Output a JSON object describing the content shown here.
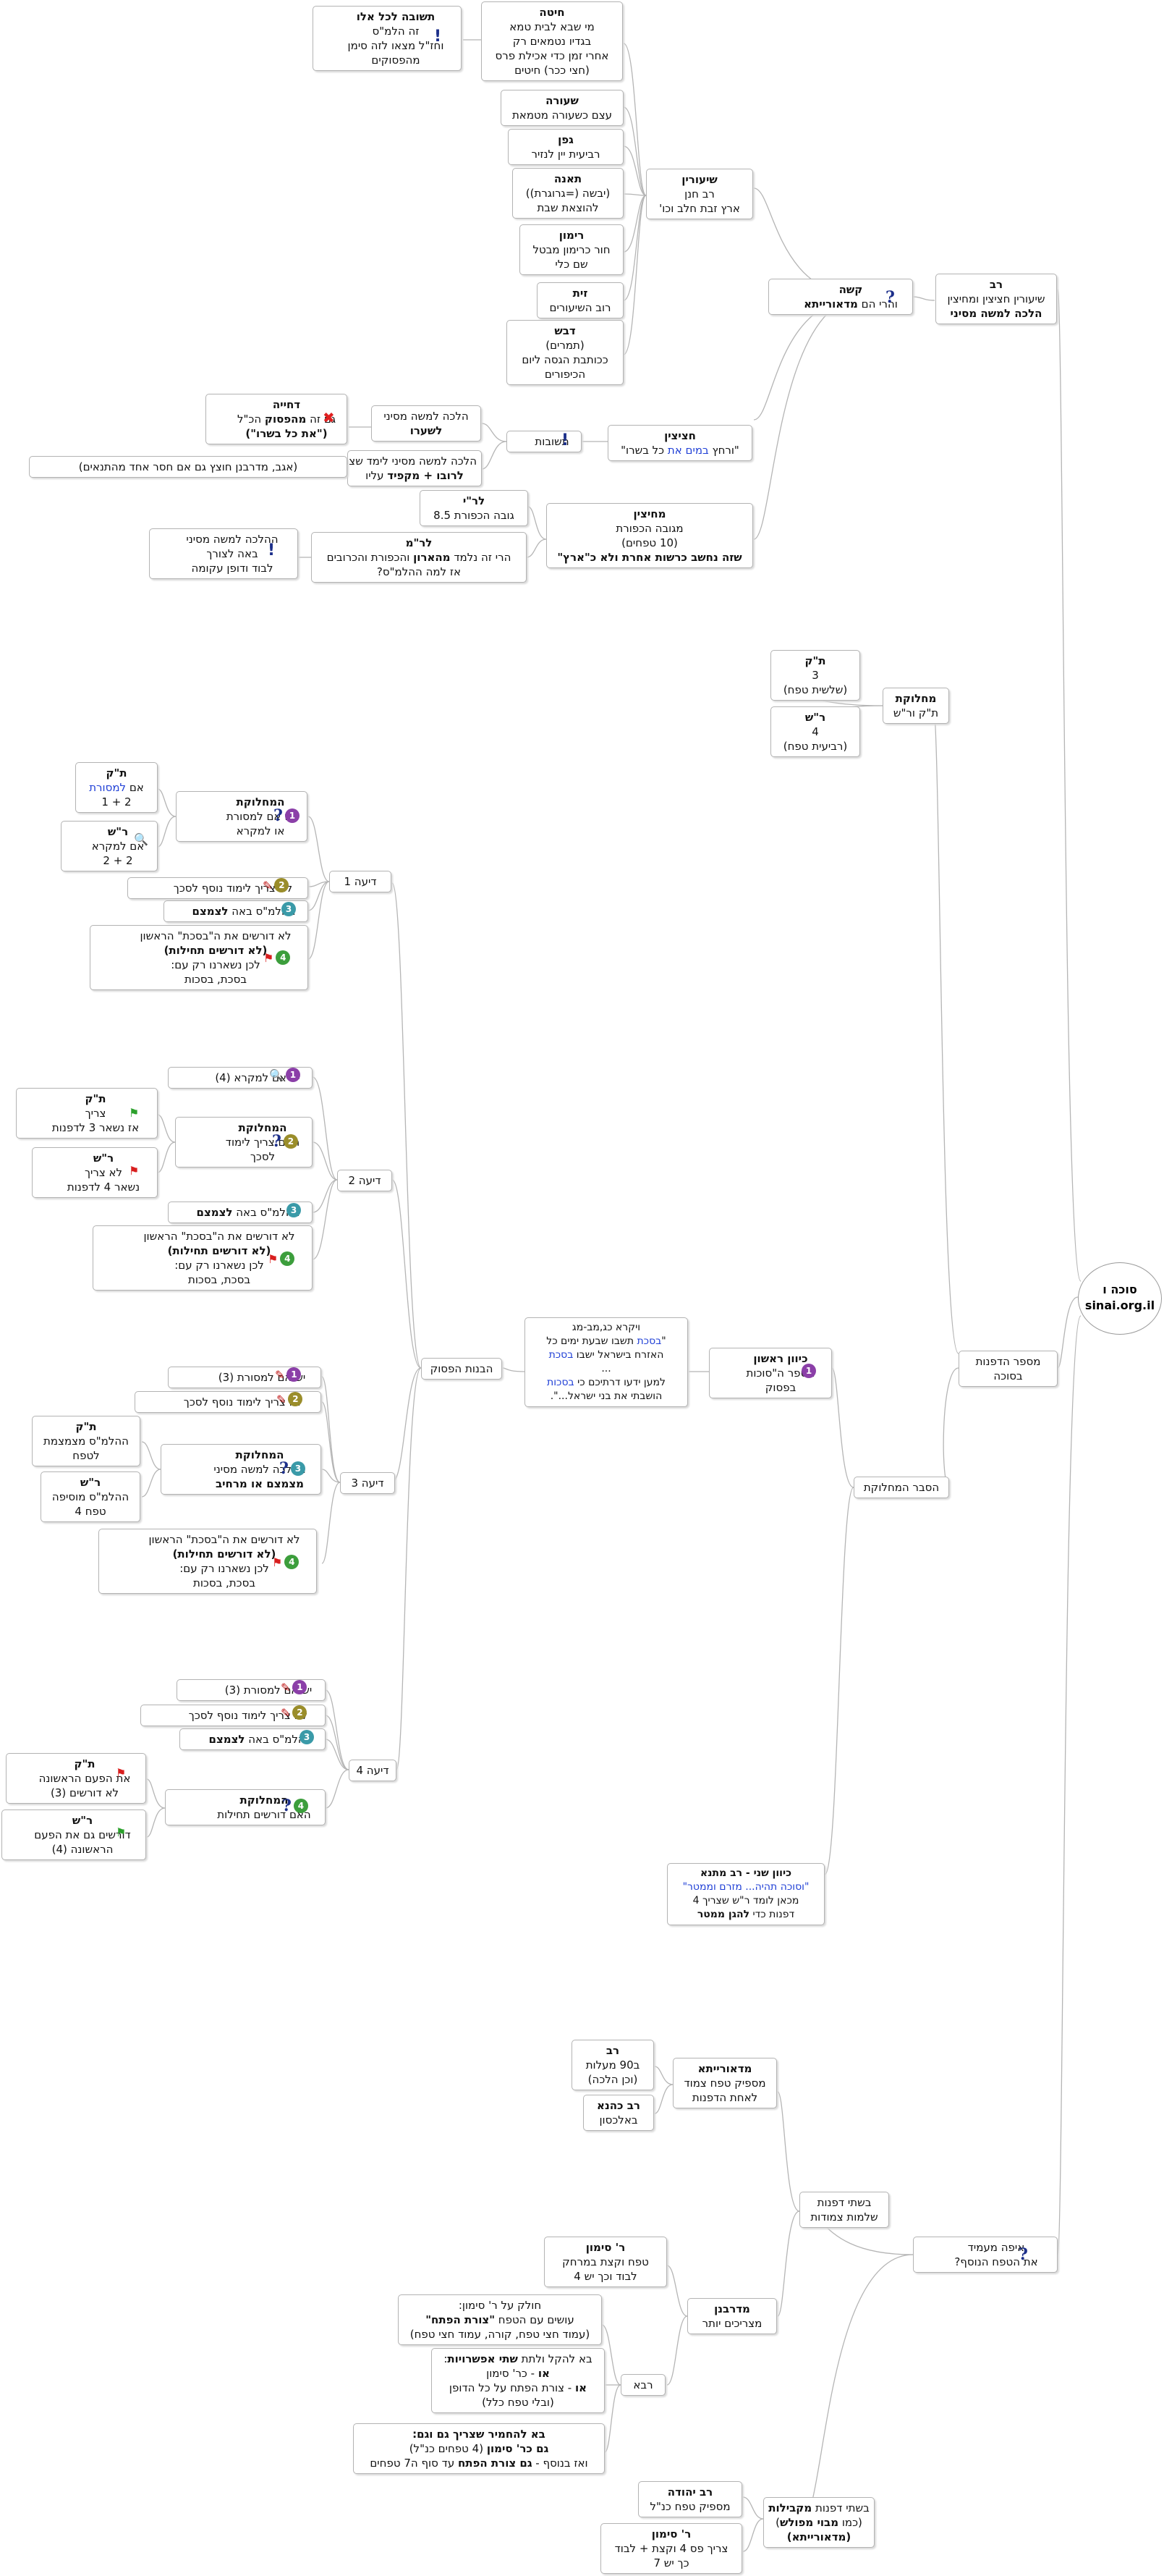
{
  "root": {
    "l1": "סוכה ו",
    "l2": "sinai.org.il"
  },
  "rav": {
    "t": "רב",
    "l1": "שיעורין חציצין ומחיצין",
    "l2": "הלכה למשה מסיני"
  },
  "kasheh": {
    "t": "קשה",
    "l1a": "והרי הם ",
    "l1b": "מדאורייתא"
  },
  "shiurin": {
    "t": "שיעורין",
    "l1": "רב חנן",
    "l2": "ארץ זבת חלב וכו'"
  },
  "chita": {
    "t": "חיטה",
    "l1": "מי שבא לבית טמא",
    "l2": "בגדיו נטמאים רק",
    "l3": "אחרי זמן כדי אכילת פרס",
    "l4": "(חצי ככר) חיטים"
  },
  "teshuva": {
    "t": "תשובה לכל אלו",
    "l1": "זה הלמ\"ס",
    "l2": "וחז\"ל מצאו לזה סימן",
    "l3": "מהפסוקים"
  },
  "seora": {
    "t": "שעורה",
    "l1": "עצם כשעורה מטמאת"
  },
  "gefen": {
    "t": "גפן",
    "l1": "רביעית יין לנזיר"
  },
  "teena": {
    "t": "תאנה",
    "l1": "(יבשה (=גרוגרת))",
    "l2": "להוצאת שבת"
  },
  "rimon": {
    "t": "רימון",
    "l1": "חור כרימון מבטל",
    "l2": "שם כלי"
  },
  "zayit": {
    "t": "זית",
    "l1": "רוב השיעורים"
  },
  "dvash": {
    "t": "דבש",
    "l1": "(תמרים)",
    "l2": "ככותבת הגסה ליום",
    "l3": "הכיפורים"
  },
  "chatzitzin": {
    "t": "חציצין",
    "l1a": "\"ורחץ ",
    "l1b": "במים את",
    "l1c": " כל בשרו\""
  },
  "teshuvot": {
    "l1": "תשובות"
  },
  "hlmm_sheiro": {
    "l1": "הלכה למשה מסיני",
    "l2": "לשערו"
  },
  "dchiya": {
    "t": "דחייה",
    "l1a": "גם זה ",
    "l1b": "מהפסוק",
    "l1c": " הכ\"ל",
    "l2": "(\"את כל בשרו\")"
  },
  "hlmm_tzarich": {
    "l1": "הלכה למשה מסיני לימד שצריך:",
    "l2a": "לרובו + מקפיד",
    "l2b": " עליו"
  },
  "agav": {
    "l1": "(אגב, מדרבנן חוצץ גם אם חסר אחד מהתנאים)"
  },
  "mechitzin": {
    "t": "מחיצין",
    "l1": "מגובה הכפורת",
    "l2": "(10 טפחים)",
    "l3": "שזה נחשב כרשות אחרת ולא כ\"ארץ\""
  },
  "lrav": {
    "t": "לר\"י",
    "l1": "גובה הכפורת 8.5"
  },
  "lram": {
    "t": "לר\"מ",
    "l1a": "הרי זה נלמד ",
    "l1b": "מהארון",
    "l1c": " והכפורת והכרובים",
    "l2": "אז למה ההלמ\"ס?"
  },
  "halacha_lvad": {
    "l1": "ההלכה למשה מסיני",
    "l2": "באה לצורך",
    "l3": "לבוד ודופן עקומה"
  },
  "machloket_tk": {
    "t": "מחלוקת",
    "l1": "ת\"ק ור\"ש"
  },
  "tk_top": {
    "t": "ת\"ק",
    "l1": "3",
    "l2": "(שלשית טפח)"
  },
  "rs_top": {
    "t": "ר\"ש",
    "l1": "4",
    "l2": "(רביעית טפח)"
  },
  "mispar": {
    "l1": "מספר הדפנות",
    "l2": "בסוכה"
  },
  "hesber": {
    "l1": "הסבר המחלוקת"
  },
  "kivun1": {
    "t": "כיוון ראשון",
    "l1": "מספר ה\"סוכות",
    "l2": "בפסוק"
  },
  "verse1": {
    "l1": "ויקרא כג,מב-מג",
    "l2a": "\"",
    "l2b": "בסכת",
    "l2c": " תשבו שבעת ימים כל",
    "l3a": "האזרח בישראל ישבו ",
    "l3b": "בסכת",
    "l4": "...",
    "l5": "למען ידעו דרתיכם כי ",
    "l5b": "בסכות",
    "l6": "הושבתי את בני ישראל...\"."
  },
  "havanat": {
    "l1": "הבנות הפסוק"
  },
  "deia1": {
    "l1": "דיעה 1"
  },
  "deia2": {
    "l1": "דיעה 2"
  },
  "deia3": {
    "l1": "דיעה 3"
  },
  "deia4": {
    "l1": "דיעה 4"
  },
  "d1_mach": {
    "t": "המחלוקת",
    "l1": "יש אם למסורת",
    "l2": "או למקרא"
  },
  "d1_tk": {
    "t": "ת\"ק",
    "l1a": "אם ",
    "l1b": "למסורת",
    "l2": "2 + 1"
  },
  "d1_rs": {
    "t": "ר\"ש",
    "l1": "אם למקרא",
    "l2": "2 + 2"
  },
  "d1_n2": {
    "l1": "לא צריך לימוד נוסף לסכך"
  },
  "d1_n3": {
    "l1": "ההלמ\"ס באה ",
    "l1b": "לצמצם"
  },
  "d1_n4": {
    "l1": "לא דורשים את ה\"בסכת\" הראשון",
    "l2": "(לא דורשים תחילות)",
    "l3": "לכן נשארנו רק עם:",
    "l4": "בסכת, בסכות"
  },
  "d2_n1": {
    "l1": "יש אם למקרא (4)"
  },
  "d2_mach": {
    "t": "המחלוקת",
    "l1": "האם צריך לימוד",
    "l2": "לסכך"
  },
  "d2_tk": {
    "t": "ת\"ק",
    "l1": "צריך",
    "l2": "אז נשאר 3 לדפנות"
  },
  "d2_rs": {
    "t": "ר\"ש",
    "l1": "לא צריך",
    "l2": "נשאר 4 לדפנות"
  },
  "d2_n3": {
    "l1": "ההלמ\"ס באה ",
    "l1b": "לצמצם"
  },
  "d2_n4": {
    "l1": "לא דורשים את ה\"בסכת\" הראשון",
    "l2": "(לא דורשים תחילות)",
    "l3": "לכן נשארנו רק עם:",
    "l4": "בסכת, בסכות"
  },
  "d3_n1": {
    "l1": "יש אם למסורת (3)"
  },
  "d3_n2": {
    "l1": "לא צריך לימוד נוסף לסכך"
  },
  "d3_mach": {
    "t": "המחלוקת",
    "l1": "ההלכה למשה מסיני",
    "l2": "מצמצם או מרחיב"
  },
  "d3_tk": {
    "t": "ת\"ק",
    "l1": "ההלמ\"ס מצמצמת",
    "l2": "לטפח"
  },
  "d3_rs": {
    "t": "ר\"ש",
    "l1": "ההלמ\"ס מוסיפה",
    "l2": "טפח 4"
  },
  "d3_n4": {
    "l1": "לא דורשים את ה\"בסכת\" הראשון",
    "l2": "(לא דורשים תחילות)",
    "l3": "לכן נשארנו רק עם:",
    "l4": "בסכת, בסכות"
  },
  "d4_n1": {
    "l1": "יש אם למסורת (3)"
  },
  "d4_n2": {
    "l1": "לא צריך לימוד נוסף לסכך"
  },
  "d4_n3": {
    "l1": "ההלמ\"ס באה ",
    "l1b": "לצמצם"
  },
  "d4_mach": {
    "t": "המחלוקת",
    "l1": "האם דורשים תחילות"
  },
  "d4_tk": {
    "t": "ת\"ק",
    "l1": "את הפעם הראשונה",
    "l2": "לא דורשים (3)"
  },
  "d4_rs": {
    "t": "ר\"ש",
    "l1": "דורשים גם את הפעם",
    "l2": "הראשונה (4)"
  },
  "kivun2": {
    "t": "כיוון שני - רב מתנא",
    "l1": "\"וסוכה תהיה... מזרם וממטר\"",
    "l2": "מכאן לומד ר\"ש שצריך 4",
    "l3a": "דפנות כדי ",
    "l3b": "להגן",
    "l3c": "  ממטר"
  },
  "eifo": {
    "l1": "איפה מעמיד",
    "l2": "את הטפח הנוסף?"
  },
  "shtei": {
    "l1": "בשתי דפנות",
    "l2": "שלמות צמודות"
  },
  "mideoraita": {
    "t": "מדאורייתא",
    "l1": "מספיק טפח צמוד",
    "l2": "לאחת הדפנות"
  },
  "rav90": {
    "t": "רב",
    "l1": "ב90 מעלות",
    "l2": "(וכן הלכה)"
  },
  "ravkahana": {
    "t": "רב כהנא",
    "l1": "באלכסון"
  },
  "midrabanan": {
    "t": "מדרבנן",
    "l1": "מצריכים יותר"
  },
  "rsimon": {
    "t": "ר' סימון",
    "l1": "טפח וקצת במרחק",
    "l2": "לבוד וכך יש 4"
  },
  "rava": {
    "l1": "רבא"
  },
  "choleik": {
    "l1": "חולק על ר' סימון:",
    "l2a": "עושים עם הטפח ",
    "l2b": "\"צורת הפתח\"",
    "l3": "(עמוד חצי טפח, קורה, עמוד חצי טפח)"
  },
  "baleheikel": {
    "l1a": "בא להקל ולתת ",
    "l1b": "שתי אפשרויות",
    "l1c": ":",
    "l2a": "או",
    "l2b": "  - כר' סימון",
    "l3a": "או",
    "l3b": "  - צורת  הפתח על כל הדופן",
    "l4": "(ובלי טפח כלל)"
  },
  "lehachmir": {
    "l1": "בא להחמיר שצריך גם וגם:",
    "l2a": "גם כר' סימון",
    "l2b": " (4 טפחים כנ\"ל)",
    "l3a": "ואז בנוסף - ",
    "l3b": "גם צורת הפתח",
    "l3c": "  עד סוף ה7 טפחים"
  },
  "shtei_mekabilot": {
    "l1a": "בשתי דפנות ",
    "l1b": "מקבילות",
    "l2a": "(כמו ",
    "l2b": "מבוי מפולש",
    "l2c": ")",
    "l3": "(מדאורייתא)"
  },
  "ryehuda": {
    "t": "רב יהודה",
    "l1": "מספיק טפח כנ\"ל"
  },
  "rsimon2": {
    "t": "ר' סימון",
    "l1": "צריך פס 4 וקצת + לבוד",
    "l2": "כך יש 7"
  }
}
